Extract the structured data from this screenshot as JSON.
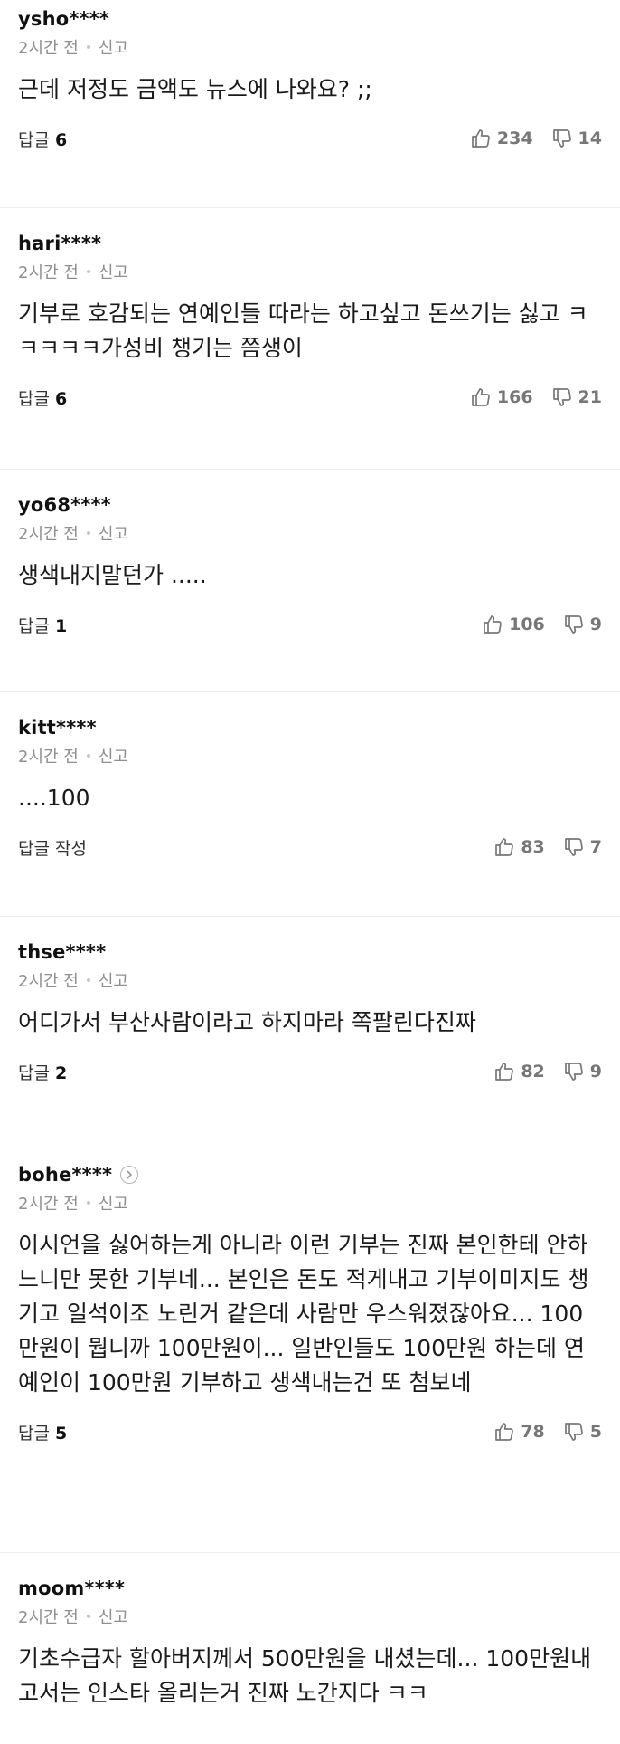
{
  "meta_labels": {
    "dot": "•"
  },
  "comments": [
    {
      "user": "ysho****",
      "time": "2시간 전",
      "report": "신고",
      "text": "근데 저정도 금액도 뉴스에 나와요? ;;",
      "reply_label": "답글",
      "reply_count": "6",
      "likes": "234",
      "dislikes": "14"
    },
    {
      "user": "hari****",
      "time": "2시간 전",
      "report": "신고",
      "text": "기부로 호감되는 연예인들 따라는 하고싶고 돈쓰기는 싫고 ㅋㅋㅋㅋㅋ가성비 챙기는 쯤생이",
      "reply_label": "답글",
      "reply_count": "6",
      "likes": "166",
      "dislikes": "21"
    },
    {
      "user": "yo68****",
      "time": "2시간 전",
      "report": "신고",
      "text": "생색내지말던가 .....",
      "reply_label": "답글",
      "reply_count": "1",
      "likes": "106",
      "dislikes": "9"
    },
    {
      "user": "kitt****",
      "time": "2시간 전",
      "report": "신고",
      "text": "....100",
      "reply_label": "답글 작성",
      "reply_count": "",
      "likes": "83",
      "dislikes": "7"
    },
    {
      "user": "thse****",
      "time": "2시간 전",
      "report": "신고",
      "text": "어디가서 부산사람이라고 하지마라 쪽팔린다진짜",
      "reply_label": "답글",
      "reply_count": "2",
      "likes": "82",
      "dislikes": "9"
    },
    {
      "user": "bohe****",
      "time": "2시간 전",
      "report": "신고",
      "text": "이시언을 싫어하는게 아니라 이런 기부는 진짜 본인한테 안하느니만 못한 기부네... 본인은 돈도 적게내고 기부이미지도 챙기고 일석이조 노린거 같은데 사람만 우스워졌잖아요... 100만원이 뭡니까 100만원이... 일반인들도 100만원 하는데 연예인이 100만원 기부하고 생색내는건 또 첨보네",
      "reply_label": "답글",
      "reply_count": "5",
      "likes": "78",
      "dislikes": "5"
    },
    {
      "user": "moom****",
      "time": "2시간 전",
      "report": "신고",
      "text": "기초수급자 할아버지께서 500만원을 내셨는데... 100만원내고서는 인스타 올리는거 진짜 노간지다 ㅋㅋ"
    }
  ]
}
